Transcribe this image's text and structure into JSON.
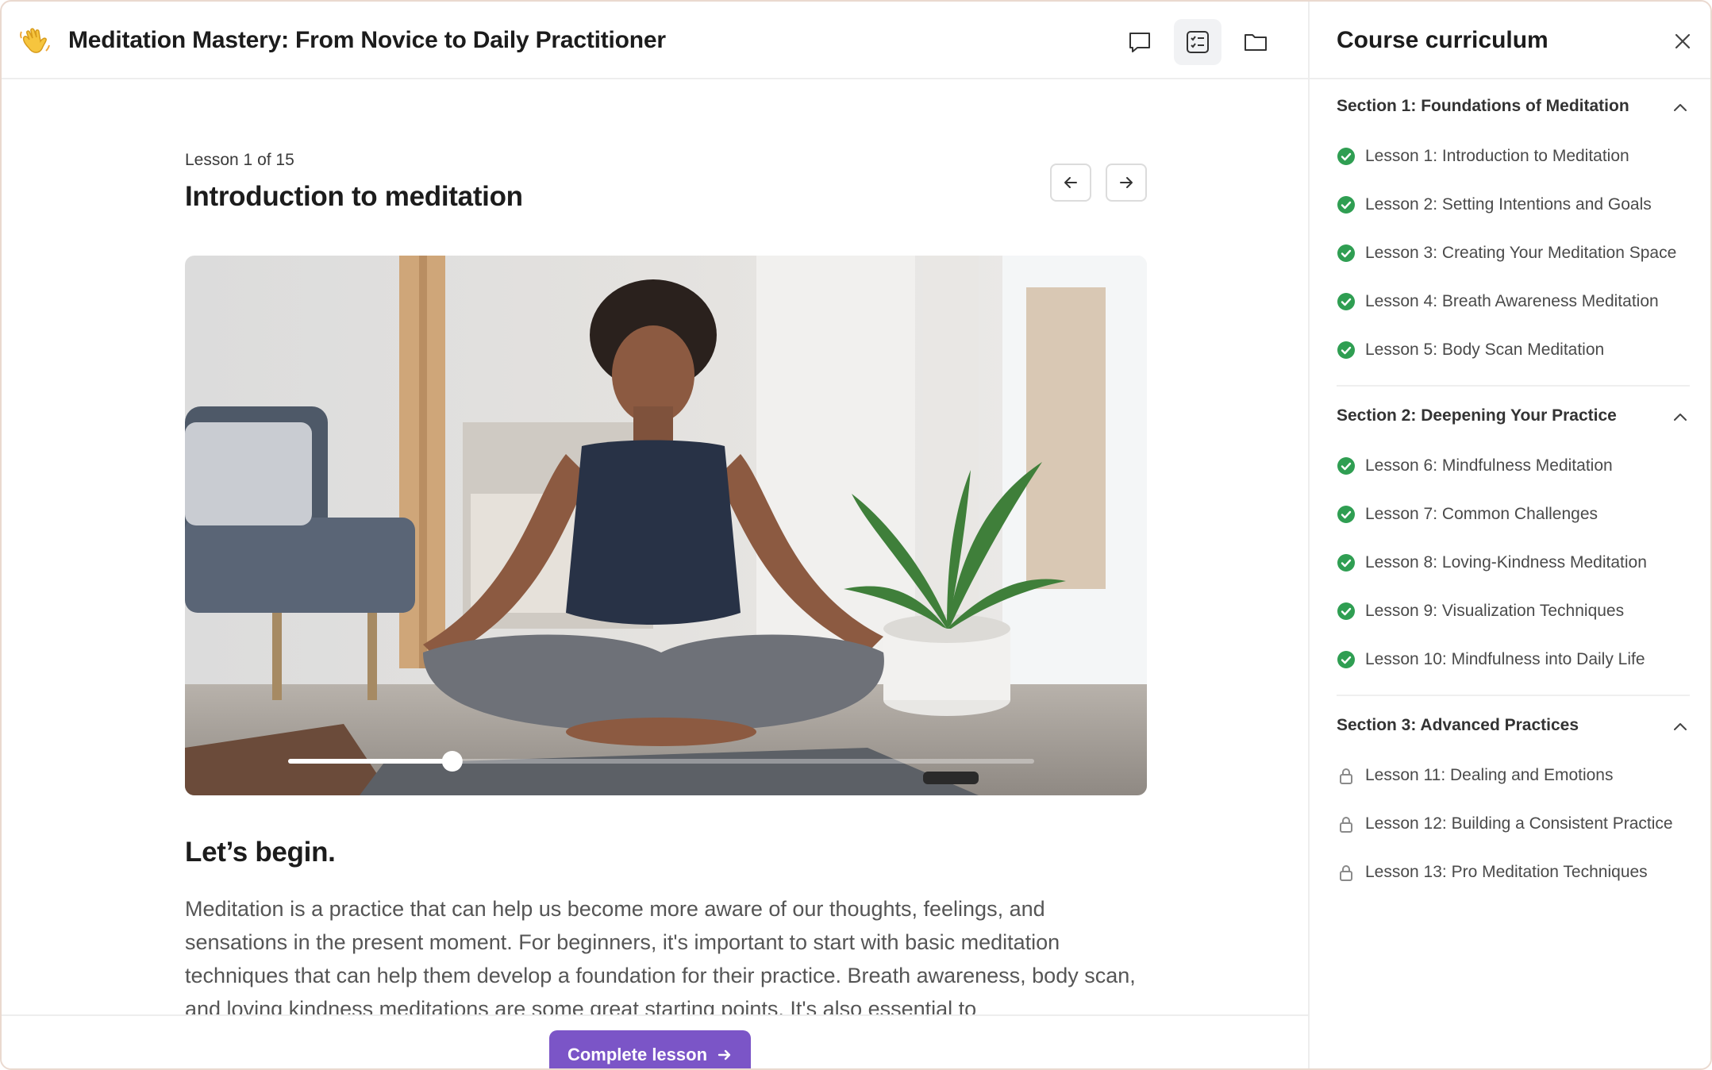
{
  "header": {
    "course_title": "Meditation Mastery: From Novice to Daily Practitioner",
    "icons": [
      "waving-hand-icon",
      "chat-bubble-icon",
      "checklist-icon",
      "folder-icon"
    ]
  },
  "lesson": {
    "counter": "Lesson 1 of 15",
    "title": "Introduction to meditation",
    "video_progress": 0.22,
    "heading": "Let’s begin.",
    "body": "Meditation is a practice that can help us become more aware of our thoughts, feelings, and sensations in the present moment. For beginners, it's important to start with basic meditation techniques that can help them develop a foundation for their practice. Breath awareness, body scan, and loving kindness meditations are some great starting points. It's also essential to"
  },
  "footer": {
    "complete_label": "Complete lesson"
  },
  "sidebar": {
    "title": "Course curriculum",
    "sections": [
      {
        "title": "Section 1: Foundations of Meditation",
        "items": [
          {
            "label": "Lesson 1: Introduction to Meditation",
            "status": "complete"
          },
          {
            "label": "Lesson 2: Setting Intentions and Goals",
            "status": "complete"
          },
          {
            "label": "Lesson 3: Creating Your Meditation Space",
            "status": "complete"
          },
          {
            "label": "Lesson 4: Breath Awareness Meditation",
            "status": "complete"
          },
          {
            "label": "Lesson 5: Body Scan Meditation",
            "status": "complete"
          }
        ]
      },
      {
        "title": "Section 2: Deepening Your Practice",
        "items": [
          {
            "label": "Lesson 6: Mindfulness Meditation",
            "status": "complete"
          },
          {
            "label": "Lesson 7: Common Challenges",
            "status": "complete"
          },
          {
            "label": "Lesson 8: Loving-Kindness Meditation",
            "status": "complete"
          },
          {
            "label": "Lesson 9: Visualization Techniques",
            "status": "complete"
          },
          {
            "label": "Lesson 10: Mindfulness into Daily Life",
            "status": "complete"
          }
        ]
      },
      {
        "title": "Section 3: Advanced Practices",
        "items": [
          {
            "label": "Lesson 11: Dealing and Emotions",
            "status": "locked"
          },
          {
            "label": "Lesson 12: Building a Consistent Practice",
            "status": "locked"
          },
          {
            "label": "Lesson 13: Pro Meditation Techniques",
            "status": "locked"
          }
        ]
      }
    ]
  },
  "colors": {
    "accent": "#7b55c7",
    "complete_green": "#2f9e52",
    "lock_gray": "#8a8a8a"
  }
}
